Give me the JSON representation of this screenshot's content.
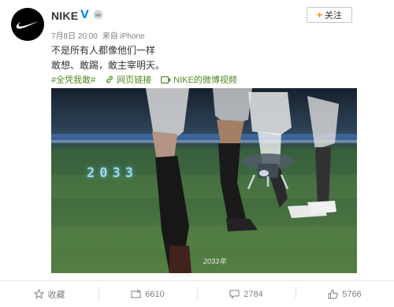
{
  "post": {
    "username": "NIKE",
    "follow_label": "关注",
    "meta_date": "7月8日 20:00",
    "meta_from": "来自 iPhone",
    "text_line1": "不是所有人都像他们一样",
    "text_line2": "敢想、敢踢，敢主宰明天。",
    "hashtag": "#全凭我敢#",
    "link_label": "网页链接",
    "video_link_label": "NIKE的微博视频"
  },
  "video": {
    "overlay_digits": "2033",
    "caption": "2033年"
  },
  "actions": {
    "favorite_label": "收藏",
    "repost_count": "6610",
    "comment_count": "2784",
    "like_count": "5766"
  },
  "colors": {
    "link_green": "#4e8a22",
    "follow_orange": "#ff8200",
    "verified_blue": "#1c8fe3"
  }
}
